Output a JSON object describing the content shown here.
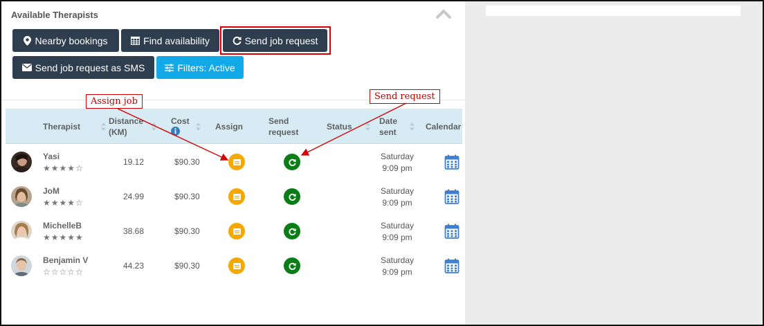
{
  "panel": {
    "title": "Available Therapists"
  },
  "buttons": {
    "nearby": "Nearby bookings",
    "find": "Find availability",
    "send": "Send job request",
    "sms": "Send job request as SMS",
    "filters": "Filters: Active"
  },
  "table": {
    "headers": {
      "therapist": "Therapist",
      "distance_1": "Distance",
      "distance_2": "(KM)",
      "cost": "Cost",
      "assign": "Assign",
      "send_1": "Send",
      "send_2": "request",
      "status": "Status",
      "date_1": "Date",
      "date_2": "sent",
      "calendar": "Calendar"
    },
    "rows": [
      {
        "name": "Yasi",
        "stars": "★★★★☆",
        "rating": 4,
        "distance": "19.12",
        "cost": "$90.30",
        "status": "",
        "date_day": "Saturday",
        "date_time": "9:09 pm"
      },
      {
        "name": "JoM",
        "stars": "★★★★☆",
        "rating": 4,
        "distance": "24.99",
        "cost": "$90.30",
        "status": "",
        "date_day": "Saturday",
        "date_time": "9:09 pm"
      },
      {
        "name": "MichelleB",
        "stars": "★★★★★",
        "rating": 5,
        "distance": "38.68",
        "cost": "$90.30",
        "status": "",
        "date_day": "Saturday",
        "date_time": "9:09 pm"
      },
      {
        "name": "Benjamin V",
        "stars": "☆☆☆☆☆",
        "rating": 0,
        "distance": "44.23",
        "cost": "$90.30",
        "status": "",
        "date_day": "Saturday",
        "date_time": "9:09 pm"
      }
    ]
  },
  "annotations": {
    "assign_job": "Assign job",
    "send_request": "Send request"
  },
  "colors": {
    "dark_button": "#2e3e4f",
    "filter_button": "#12a9e9",
    "assign": "#f5a800",
    "send": "#0a7d16",
    "highlight": "#d40000",
    "header_bg": "#d7ebf5",
    "calendar": "#3f7fd1"
  },
  "icons": [
    "map-marker-icon",
    "calendar-grid-icon",
    "refresh-icon",
    "envelope-icon",
    "sliders-icon",
    "chevron-up-icon",
    "info-icon",
    "sort-icon",
    "assign-card-icon",
    "calendar-icon"
  ]
}
